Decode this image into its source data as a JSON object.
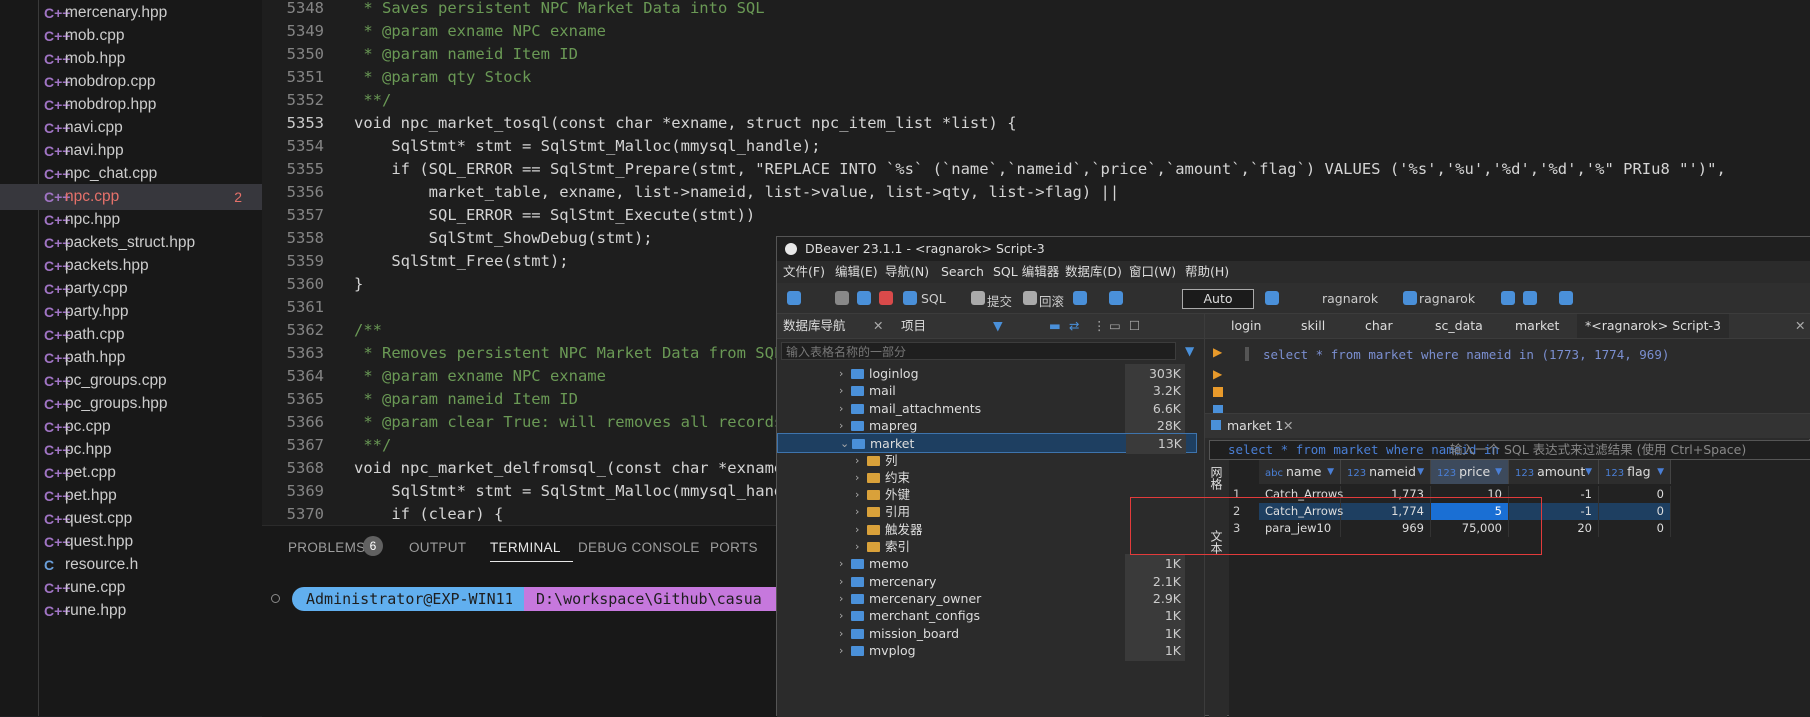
{
  "explorer": {
    "files": [
      {
        "icon": "C++",
        "name": "mercenary.hpp"
      },
      {
        "icon": "C++",
        "name": "mob.cpp"
      },
      {
        "icon": "C++",
        "name": "mob.hpp"
      },
      {
        "icon": "C++",
        "name": "mobdrop.cpp"
      },
      {
        "icon": "C++",
        "name": "mobdrop.hpp"
      },
      {
        "icon": "C++",
        "name": "navi.cpp"
      },
      {
        "icon": "C++",
        "name": "navi.hpp"
      },
      {
        "icon": "C++",
        "name": "npc_chat.cpp"
      },
      {
        "icon": "C++",
        "name": "npc.cpp",
        "badge": "2"
      },
      {
        "icon": "C++",
        "name": "npc.hpp"
      },
      {
        "icon": "C++",
        "name": "packets_struct.hpp"
      },
      {
        "icon": "C++",
        "name": "packets.hpp"
      },
      {
        "icon": "C++",
        "name": "party.cpp"
      },
      {
        "icon": "C++",
        "name": "party.hpp"
      },
      {
        "icon": "C++",
        "name": "path.cpp"
      },
      {
        "icon": "C++",
        "name": "path.hpp"
      },
      {
        "icon": "C++",
        "name": "pc_groups.cpp"
      },
      {
        "icon": "C++",
        "name": "pc_groups.hpp"
      },
      {
        "icon": "C++",
        "name": "pc.cpp"
      },
      {
        "icon": "C++",
        "name": "pc.hpp"
      },
      {
        "icon": "C++",
        "name": "pet.cpp"
      },
      {
        "icon": "C++",
        "name": "pet.hpp"
      },
      {
        "icon": "C++",
        "name": "quest.cpp"
      },
      {
        "icon": "C++",
        "name": "quest.hpp"
      },
      {
        "icon": "C",
        "name": "resource.h"
      },
      {
        "icon": "C++",
        "name": "rune.cpp"
      },
      {
        "icon": "C++",
        "name": "rune.hpp"
      }
    ]
  },
  "editor": {
    "current_line": "5353",
    "lines": [
      {
        "n": "5348",
        "t": " * Saves persistent NPC Market Data into SQL"
      },
      {
        "n": "5349",
        "t": " * @param exname NPC exname"
      },
      {
        "n": "5350",
        "t": " * @param nameid Item ID"
      },
      {
        "n": "5351",
        "t": " * @param qty Stock"
      },
      {
        "n": "5352",
        "t": " **/"
      },
      {
        "n": "5353",
        "t": "void npc_market_tosql(const char *exname, struct npc_item_list *list) {"
      },
      {
        "n": "5354",
        "t": "    SqlStmt* stmt = SqlStmt_Malloc(mmysql_handle);"
      },
      {
        "n": "5355",
        "t": "    if (SQL_ERROR == SqlStmt_Prepare(stmt, \"REPLACE INTO `%s` (`name`,`nameid`,`price`,`amount`,`flag`) VALUES ('%s','%u','%d','%d','%\" PRIu8 \"')\","
      },
      {
        "n": "5356",
        "t": "        market_table, exname, list->nameid, list->value, list->qty, list->flag) ||"
      },
      {
        "n": "5357",
        "t": "        SQL_ERROR == SqlStmt_Execute(stmt))"
      },
      {
        "n": "5358",
        "t": "        SqlStmt_ShowDebug(stmt);"
      },
      {
        "n": "5359",
        "t": "    SqlStmt_Free(stmt);"
      },
      {
        "n": "5360",
        "t": "}"
      },
      {
        "n": "5361",
        "t": ""
      },
      {
        "n": "5362",
        "t": "/**"
      },
      {
        "n": "5363",
        "t": " * Removes persistent NPC Market Data from SQL"
      },
      {
        "n": "5364",
        "t": " * @param exname NPC exname"
      },
      {
        "n": "5365",
        "t": " * @param nameid Item ID"
      },
      {
        "n": "5366",
        "t": " * @param clear True: will removes all records"
      },
      {
        "n": "5367",
        "t": " **/"
      },
      {
        "n": "5368",
        "t": "void npc_market_delfromsql_(const char *exname"
      },
      {
        "n": "5369",
        "t": "    SqlStmt* stmt = SqlStmt_Malloc(mmysql_hand"
      },
      {
        "n": "5370",
        "t": "    if (clear) {"
      }
    ]
  },
  "panel": {
    "tabs": [
      "PROBLEMS",
      "OUTPUT",
      "TERMINAL",
      "DEBUG CONSOLE",
      "PORTS"
    ],
    "problems_count": "6",
    "active_tab": "TERMINAL",
    "prompt_user": "Administrator@EXP-WIN11",
    "prompt_path": "D:\\workspace\\Github\\casua"
  },
  "dbeaver": {
    "title": "DBeaver 23.1.1 - <ragnarok> Script-3",
    "menu": [
      "文件(F)",
      "编辑(E)",
      "导航(N)",
      "Search",
      "SQL 编辑器",
      "数据库(D)",
      "窗口(W)",
      "帮助(H)"
    ],
    "toolbar": {
      "sql": "SQL",
      "commit": "提交",
      "rollback": "回滚",
      "auto": "Auto",
      "db1": "ragnarok",
      "db2": "ragnarok"
    },
    "nav_tabs": [
      "数据库导航",
      "项目"
    ],
    "nav_filter_placeholder": "输入表格名称的一部分",
    "tree": [
      {
        "label": "loginlog",
        "size": "303K",
        "level": 1,
        "kind": "table"
      },
      {
        "label": "mail",
        "size": "3.2K",
        "level": 1,
        "kind": "table"
      },
      {
        "label": "mail_attachments",
        "size": "6.6K",
        "level": 1,
        "kind": "table"
      },
      {
        "label": "mapreg",
        "size": "28K",
        "level": 1,
        "kind": "table"
      },
      {
        "label": "market",
        "size": "13K",
        "level": 1,
        "kind": "table",
        "open": true,
        "selected": true
      },
      {
        "label": "列",
        "size": "",
        "level": 2,
        "kind": "folder"
      },
      {
        "label": "约束",
        "size": "",
        "level": 2,
        "kind": "folder"
      },
      {
        "label": "外键",
        "size": "",
        "level": 2,
        "kind": "folder"
      },
      {
        "label": "引用",
        "size": "",
        "level": 2,
        "kind": "folder"
      },
      {
        "label": "触发器",
        "size": "",
        "level": 2,
        "kind": "folder"
      },
      {
        "label": "索引",
        "size": "",
        "level": 2,
        "kind": "folder"
      },
      {
        "label": "memo",
        "size": "1K",
        "level": 1,
        "kind": "table"
      },
      {
        "label": "mercenary",
        "size": "2.1K",
        "level": 1,
        "kind": "table"
      },
      {
        "label": "mercenary_owner",
        "size": "2.9K",
        "level": 1,
        "kind": "table"
      },
      {
        "label": "merchant_configs",
        "size": "1K",
        "level": 1,
        "kind": "table"
      },
      {
        "label": "mission_board",
        "size": "1K",
        "level": 1,
        "kind": "table"
      },
      {
        "label": "mvplog",
        "size": "1K",
        "level": 1,
        "kind": "table"
      }
    ],
    "editor_tabs": [
      "login",
      "skill",
      "char",
      "sc_data",
      "market",
      "*<ragnarok> Script-3"
    ],
    "sql": "select * from market where nameid in (1773, 1774, 969)",
    "results_tab": "market 1",
    "filter_query": "select * from market where nameid in",
    "filter_placeholder": "输入一个 SQL 表达式来过滤结果 (使用 Ctrl+Space)",
    "side_labels": [
      "网格",
      "文本"
    ],
    "columns": [
      {
        "type": "abc",
        "name": "name"
      },
      {
        "type": "123",
        "name": "nameid"
      },
      {
        "type": "123",
        "name": "price"
      },
      {
        "type": "123",
        "name": "amount"
      },
      {
        "type": "123",
        "name": "flag"
      }
    ],
    "rows": [
      {
        "n": "1",
        "name": "Catch_Arrows",
        "nameid": "1,773",
        "price": "10",
        "amount": "-1",
        "flag": "0"
      },
      {
        "n": "2",
        "name": "Catch_Arrows",
        "nameid": "1,774",
        "price": "5",
        "amount": "-1",
        "flag": "0"
      },
      {
        "n": "3",
        "name": "para_jew10",
        "nameid": "969",
        "price": "75,000",
        "amount": "20",
        "flag": "0"
      }
    ]
  }
}
